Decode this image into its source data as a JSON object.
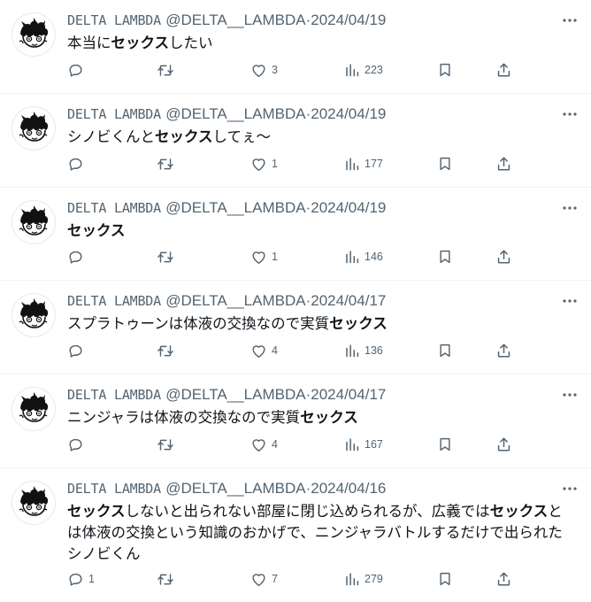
{
  "author": {
    "name": "DELTA LAMBDA",
    "handle": "@DELTA__LAMBDA",
    "separator": "·"
  },
  "icons": {
    "reply": "reply-icon",
    "retweet": "retweet-icon",
    "like": "heart-icon",
    "views": "views-icon",
    "bookmark": "bookmark-icon",
    "share": "share-icon",
    "more": "more-icon"
  },
  "colors": {
    "text": "#0f1419",
    "secondary": "#536471",
    "divider": "#eff3f4"
  },
  "tweets": [
    {
      "date": "2024/04/19",
      "text_parts": [
        {
          "text": "本当に",
          "bold": false
        },
        {
          "text": "セックス",
          "bold": true
        },
        {
          "text": "したい",
          "bold": false
        }
      ],
      "reply_count": "",
      "retweet_count": "",
      "like_count": "3",
      "view_count": "223"
    },
    {
      "date": "2024/04/19",
      "text_parts": [
        {
          "text": "シノビくんと",
          "bold": false
        },
        {
          "text": "セックス",
          "bold": true
        },
        {
          "text": "してぇ〜",
          "bold": false
        }
      ],
      "reply_count": "",
      "retweet_count": "",
      "like_count": "1",
      "view_count": "177"
    },
    {
      "date": "2024/04/19",
      "text_parts": [
        {
          "text": "セックス",
          "bold": true
        }
      ],
      "reply_count": "",
      "retweet_count": "",
      "like_count": "1",
      "view_count": "146"
    },
    {
      "date": "2024/04/17",
      "text_parts": [
        {
          "text": "スプラトゥーンは体液の交換なので実質",
          "bold": false
        },
        {
          "text": "セックス",
          "bold": true
        }
      ],
      "reply_count": "",
      "retweet_count": "",
      "like_count": "4",
      "view_count": "136"
    },
    {
      "date": "2024/04/17",
      "text_parts": [
        {
          "text": "ニンジャラは体液の交換なので実質",
          "bold": false
        },
        {
          "text": "セックス",
          "bold": true
        }
      ],
      "reply_count": "",
      "retweet_count": "",
      "like_count": "4",
      "view_count": "167"
    },
    {
      "date": "2024/04/16",
      "text_parts": [
        {
          "text": "セックス",
          "bold": true
        },
        {
          "text": "しないと出られない部屋に閉じ込められるが、広義では",
          "bold": false
        },
        {
          "text": "セックス",
          "bold": true
        },
        {
          "text": "とは体液の交換という知識のおかげで、ニンジャラバトルするだけで出られたシノビくん",
          "bold": false
        }
      ],
      "reply_count": "1",
      "retweet_count": "",
      "like_count": "7",
      "view_count": "279"
    }
  ]
}
